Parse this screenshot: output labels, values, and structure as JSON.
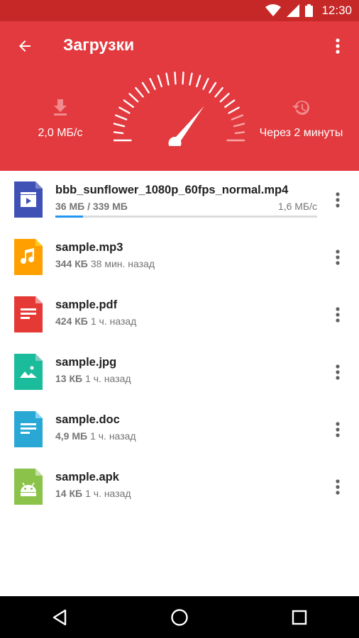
{
  "status_bar": {
    "time": "12:30"
  },
  "header": {
    "title": "Загрузки",
    "speed": "2,0 МБ/с",
    "eta": "Через 2 минуты",
    "gauge_level": 0.7
  },
  "files": [
    {
      "name": "bbb_sunflower_1080p_60fps_normal.mp4",
      "size": "36 МБ / 339 МБ",
      "speed": "1,6 МБ/с",
      "progress": 0.106,
      "type": "video",
      "color": "#3f51b5"
    },
    {
      "name": "sample.mp3",
      "size": "344 КБ",
      "time": "38 мин. назад",
      "type": "audio",
      "color": "#ffa000"
    },
    {
      "name": "sample.pdf",
      "size": "424 КБ",
      "time": "1 ч. назад",
      "type": "pdf",
      "color": "#e53935"
    },
    {
      "name": "sample.jpg",
      "size": "13 КБ",
      "time": "1 ч. назад",
      "type": "image",
      "color": "#1abc9c"
    },
    {
      "name": "sample.doc",
      "size": "4,9 МБ",
      "time": "1 ч. назад",
      "type": "doc",
      "color": "#29a8d6"
    },
    {
      "name": "sample.apk",
      "size": "14 КБ",
      "time": "1 ч. назад",
      "type": "apk",
      "color": "#8bc34a"
    }
  ],
  "colors": {
    "accent": "#e23a3f",
    "status_bar": "#c62828",
    "progress": "#2196f3"
  }
}
